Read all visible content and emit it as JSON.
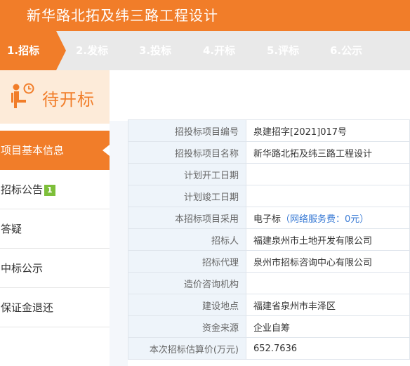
{
  "page": {
    "title": "新华路北拓及纬三路工程设计"
  },
  "steps": [
    {
      "label": "1.招标",
      "active": true
    },
    {
      "label": "2.发标",
      "active": false
    },
    {
      "label": "3.投标",
      "active": false
    },
    {
      "label": "4.开标",
      "active": false
    },
    {
      "label": "5.评标",
      "active": false
    },
    {
      "label": "6.公示",
      "active": false
    }
  ],
  "sidebar": {
    "status": {
      "text": "待开标",
      "icon": "waiting-person-clock-icon"
    },
    "items": [
      {
        "label": "项目基本信息",
        "active": true
      },
      {
        "label": "招标公告",
        "badge": "1",
        "active": false
      },
      {
        "label": "答疑",
        "active": false
      },
      {
        "label": "中标公示",
        "active": false
      },
      {
        "label": "保证金退还",
        "active": false
      }
    ]
  },
  "info": {
    "rows": [
      {
        "label": "招投标项目编号",
        "value": "泉建招字[2021]017号"
      },
      {
        "label": "招投标项目名称",
        "value": "新华路北拓及纬三路工程设计"
      },
      {
        "label": "计划开工日期",
        "value": ""
      },
      {
        "label": "计划竣工日期",
        "value": ""
      },
      {
        "label": "本招标项目采用",
        "value": "电子标",
        "fee": "（网络服务费：0元）"
      },
      {
        "label": "招标人",
        "value": "福建泉州市土地开发有限公司"
      },
      {
        "label": "招标代理",
        "value": "泉州市招标咨询中心有限公司"
      },
      {
        "label": "造价咨询机构",
        "value": ""
      },
      {
        "label": "建设地点",
        "value": "福建省泉州市丰泽区"
      },
      {
        "label": "资金来源",
        "value": "企业自筹"
      },
      {
        "label": "本次招标估算价(万元)",
        "value": "652.7636"
      }
    ]
  },
  "colors": {
    "accent": "#f17d29",
    "steps_bg": "#e9e9e9",
    "header_bg": "#fdebd9",
    "label_bg": "#eef4fa",
    "badge": "#7dbf3a",
    "link": "#3a7bd5"
  }
}
